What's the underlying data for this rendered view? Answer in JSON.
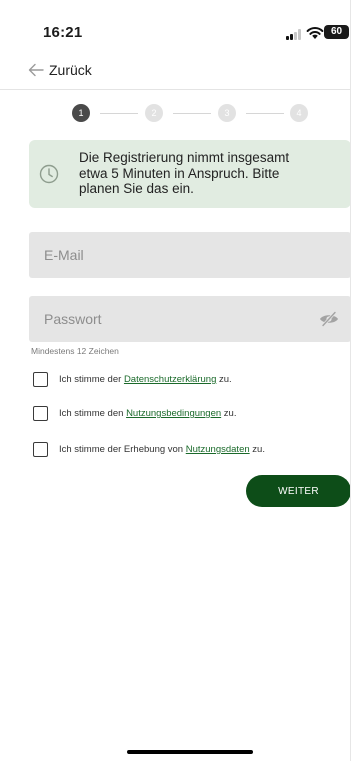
{
  "status_bar": {
    "time": "16:21",
    "battery": "60"
  },
  "nav": {
    "back_label": "Zurück"
  },
  "stepper": {
    "steps": [
      "1",
      "2",
      "3",
      "4"
    ],
    "active_step": 1
  },
  "info": {
    "text": "Die Registrierung nimmt insgesamt etwa 5 Minuten in Anspruch. Bitte planen Sie das ein."
  },
  "form": {
    "email_placeholder": "E-Mail",
    "password_placeholder": "Passwort",
    "password_hint": "Mindestens 12 Zeichen"
  },
  "consents": [
    {
      "before": "Ich stimme der ",
      "link": "Datenschutzerklärung",
      "after": " zu."
    },
    {
      "before": "Ich stimme den ",
      "link": "Nutzungsbedingungen",
      "after": " zu."
    },
    {
      "before": "Ich stimme der Erhebung von ",
      "link": "Nutzungsdaten",
      "after": " zu."
    }
  ],
  "next_button": {
    "label": "WEITER"
  },
  "colors": {
    "accent": "#0d4d18",
    "info_bg": "#e1ece1",
    "link": "#1a6a2a",
    "field_bg": "#e5e5e5"
  }
}
